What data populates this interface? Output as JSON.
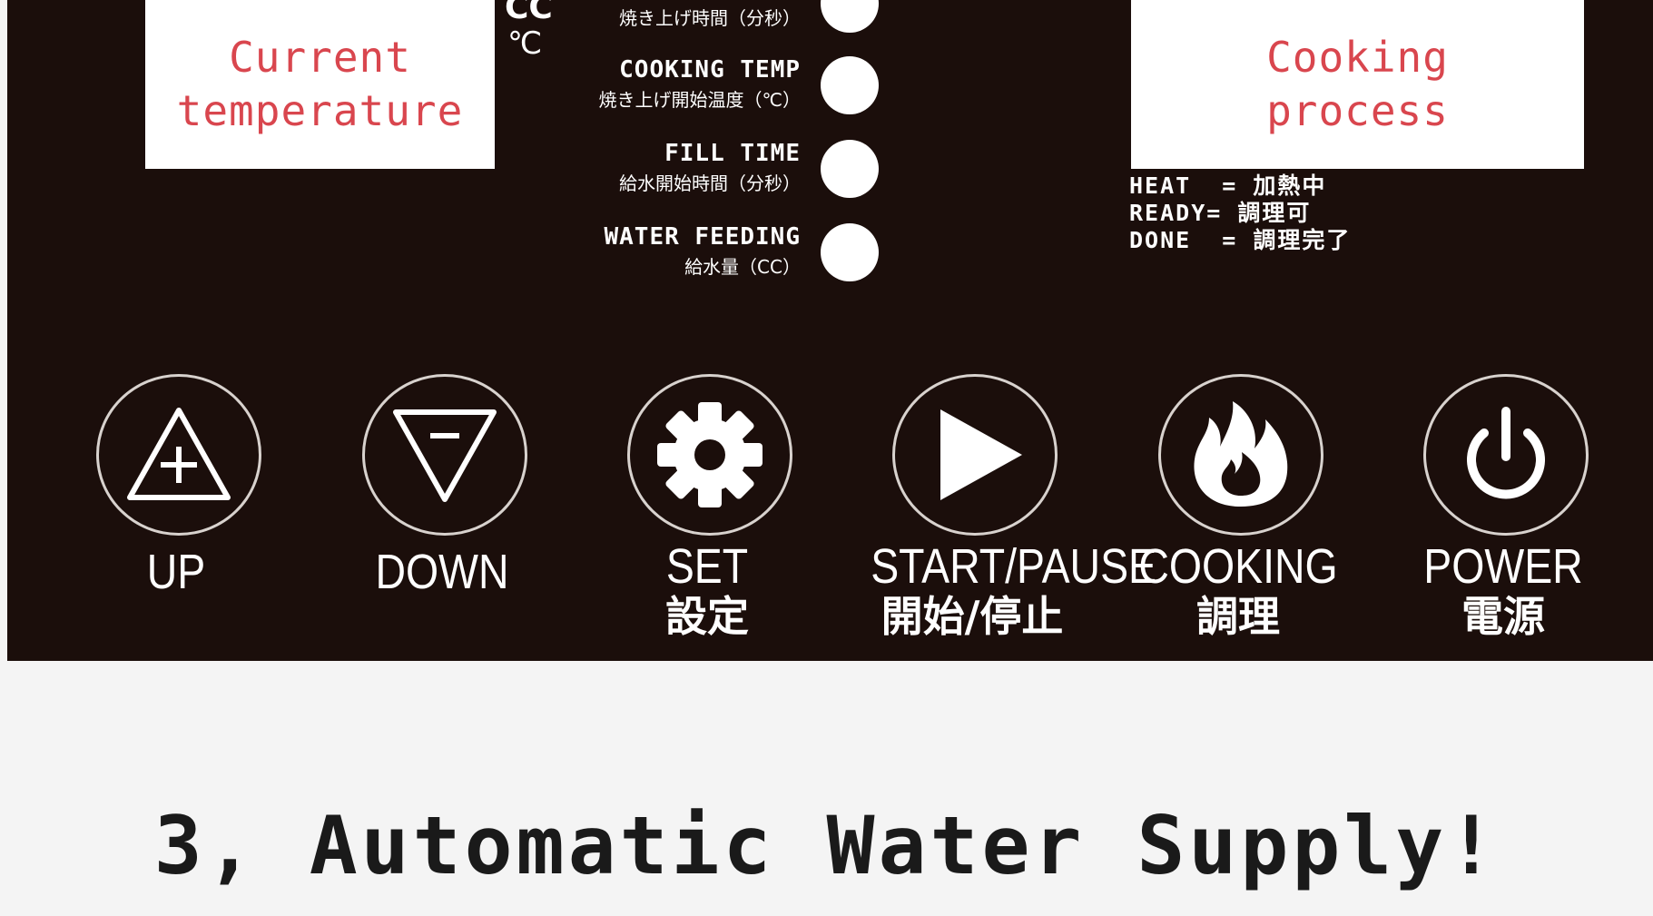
{
  "panel": {
    "display_left": {
      "line1": "Current",
      "line2": "temperature"
    },
    "display_right": {
      "line1": "Cooking",
      "line2": "process"
    },
    "units": {
      "cc": "CC",
      "celsius": "℃"
    },
    "top_partial_jp": "焼き上げ時間（分秒）",
    "indicators": [
      {
        "en": "COOKING TEMP",
        "jp": "焼き上げ開始温度（℃）"
      },
      {
        "en": "FILL TIME",
        "jp": "給水開始時間（分秒）"
      },
      {
        "en": "WATER FEEDING",
        "jp": "給水量（CC）"
      }
    ],
    "status_legend": [
      {
        "line": "HEAT  = 加熱中"
      },
      {
        "line": "READY= 調理可"
      },
      {
        "line": "DONE  = 調理完了"
      }
    ],
    "buttons": [
      {
        "icon": "up-triangle-icon",
        "label": "UP",
        "sub": ""
      },
      {
        "icon": "down-triangle-icon",
        "label": "DOWN",
        "sub": ""
      },
      {
        "icon": "gear-icon",
        "label": "SET",
        "sub": "設定"
      },
      {
        "icon": "play-icon",
        "label": "START/PAUSE",
        "sub": "開始/停止"
      },
      {
        "icon": "flame-icon",
        "label": "COOKING",
        "sub": "調理"
      },
      {
        "icon": "power-icon",
        "label": "POWER",
        "sub": "電源"
      }
    ]
  },
  "caption": "3, Automatic Water Supply!",
  "colors": {
    "panel_bg": "#1b0e0b",
    "display_text": "#d9464e",
    "page_bg": "#f4f4f4"
  }
}
